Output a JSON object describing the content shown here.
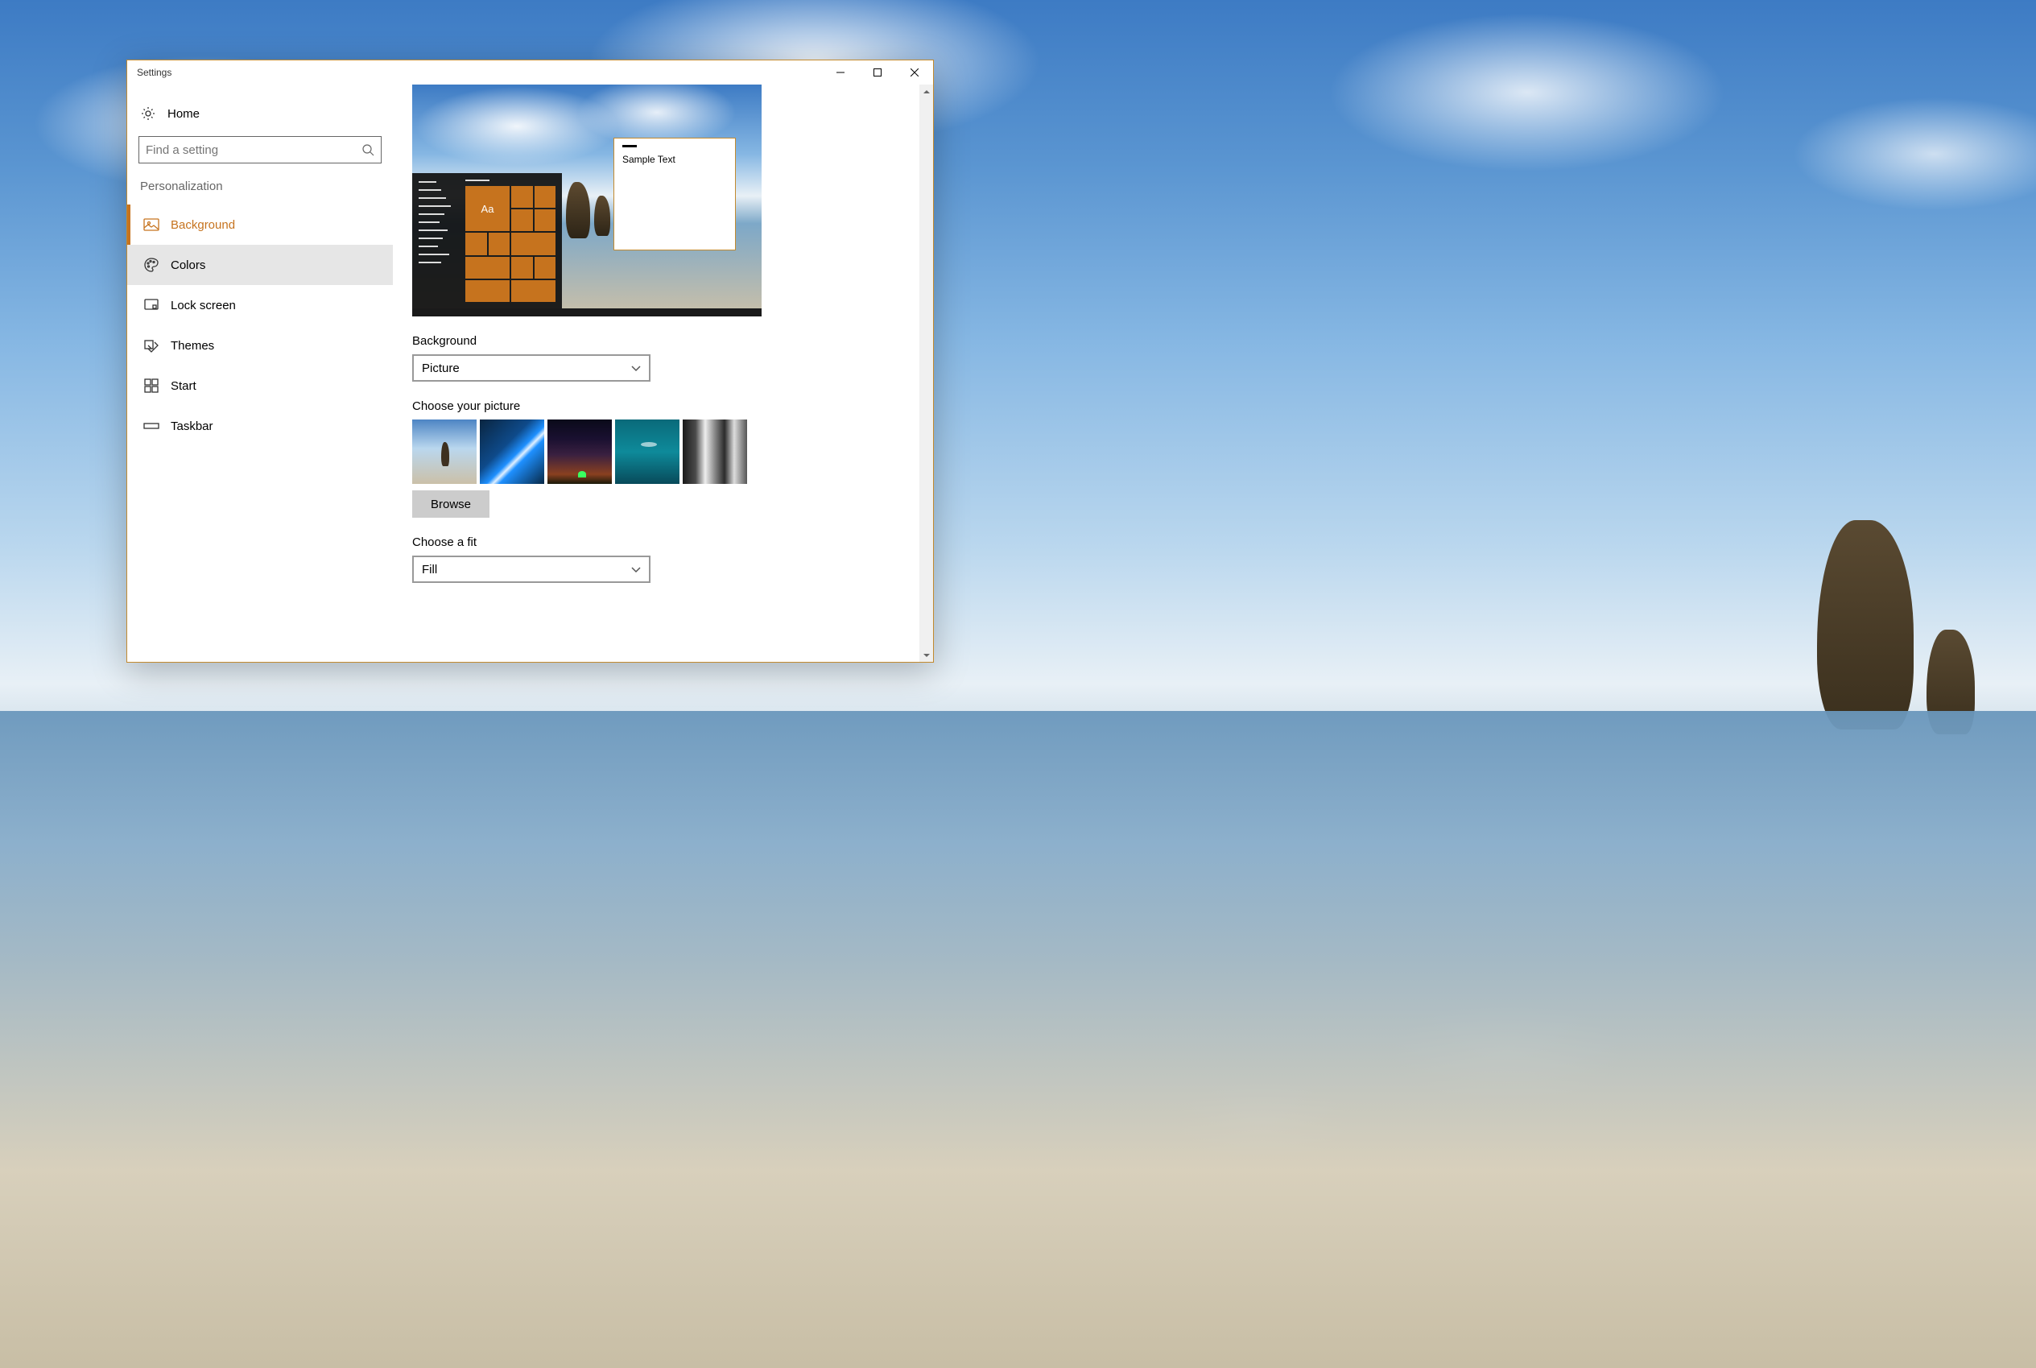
{
  "window": {
    "title": "Settings"
  },
  "sidebar": {
    "home_label": "Home",
    "search_placeholder": "Find a setting",
    "group_label": "Personalization",
    "items": [
      {
        "label": "Background",
        "icon": "picture-icon"
      },
      {
        "label": "Colors",
        "icon": "palette-icon"
      },
      {
        "label": "Lock screen",
        "icon": "lockscreen-icon"
      },
      {
        "label": "Themes",
        "icon": "themes-icon"
      },
      {
        "label": "Start",
        "icon": "start-icon"
      },
      {
        "label": "Taskbar",
        "icon": "taskbar-icon"
      }
    ]
  },
  "preview": {
    "sample_text": "Sample Text",
    "tile_text": "Aa"
  },
  "main": {
    "background_label": "Background",
    "background_value": "Picture",
    "choose_picture_label": "Choose your picture",
    "browse_label": "Browse",
    "choose_fit_label": "Choose a fit",
    "fit_value": "Fill"
  },
  "accent_color": "#c6731e"
}
